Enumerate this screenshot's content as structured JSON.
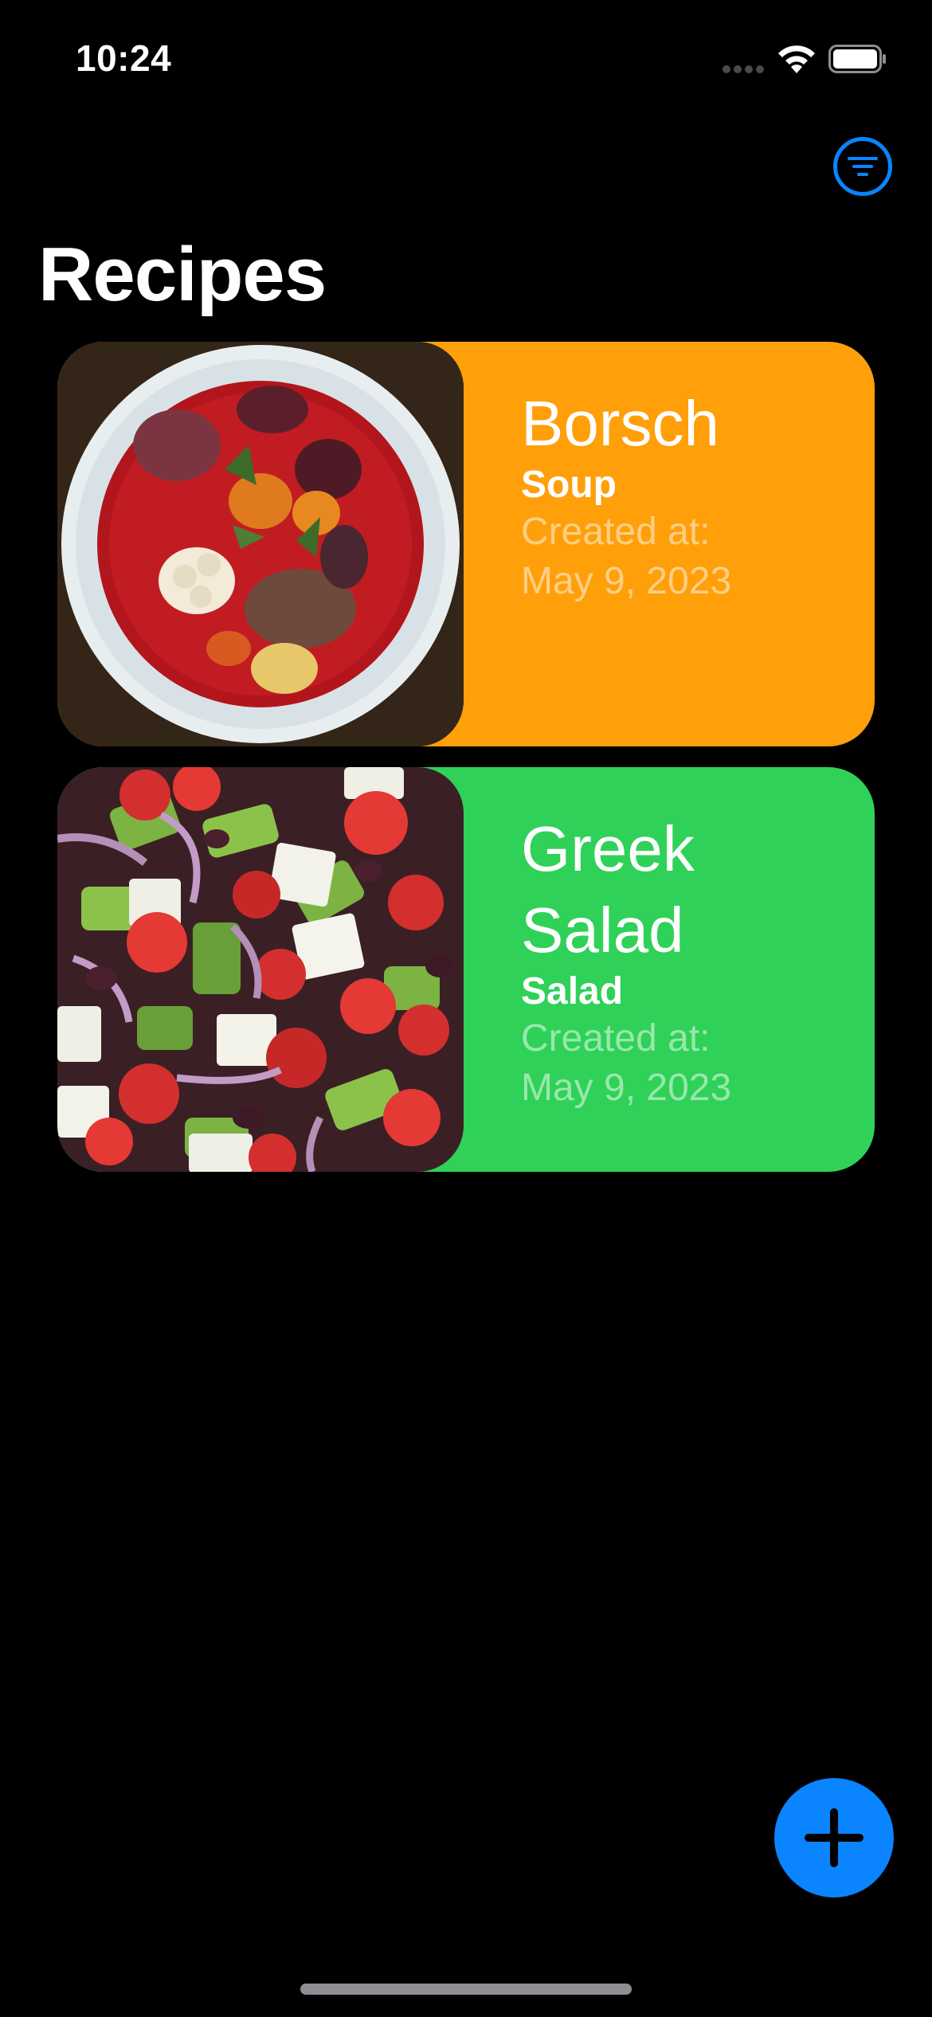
{
  "status_bar": {
    "time": "10:24"
  },
  "header": {
    "title": "Recipes",
    "filter_icon": "filter-lines-icon"
  },
  "colors": {
    "accent": "#0a84ff",
    "soup_card": "#ff9f0a",
    "salad_card": "#30d158",
    "background": "#000000"
  },
  "recipes": [
    {
      "name": "Borsch",
      "category": "Soup",
      "created_label": "Created at:",
      "created_date": "May 9, 2023",
      "color": "#ff9f0a"
    },
    {
      "name": "Greek Salad",
      "category": "Salad",
      "created_label": "Created at:",
      "created_date": "May 9, 2023",
      "color": "#30d158"
    }
  ],
  "actions": {
    "add_icon": "plus-icon"
  }
}
